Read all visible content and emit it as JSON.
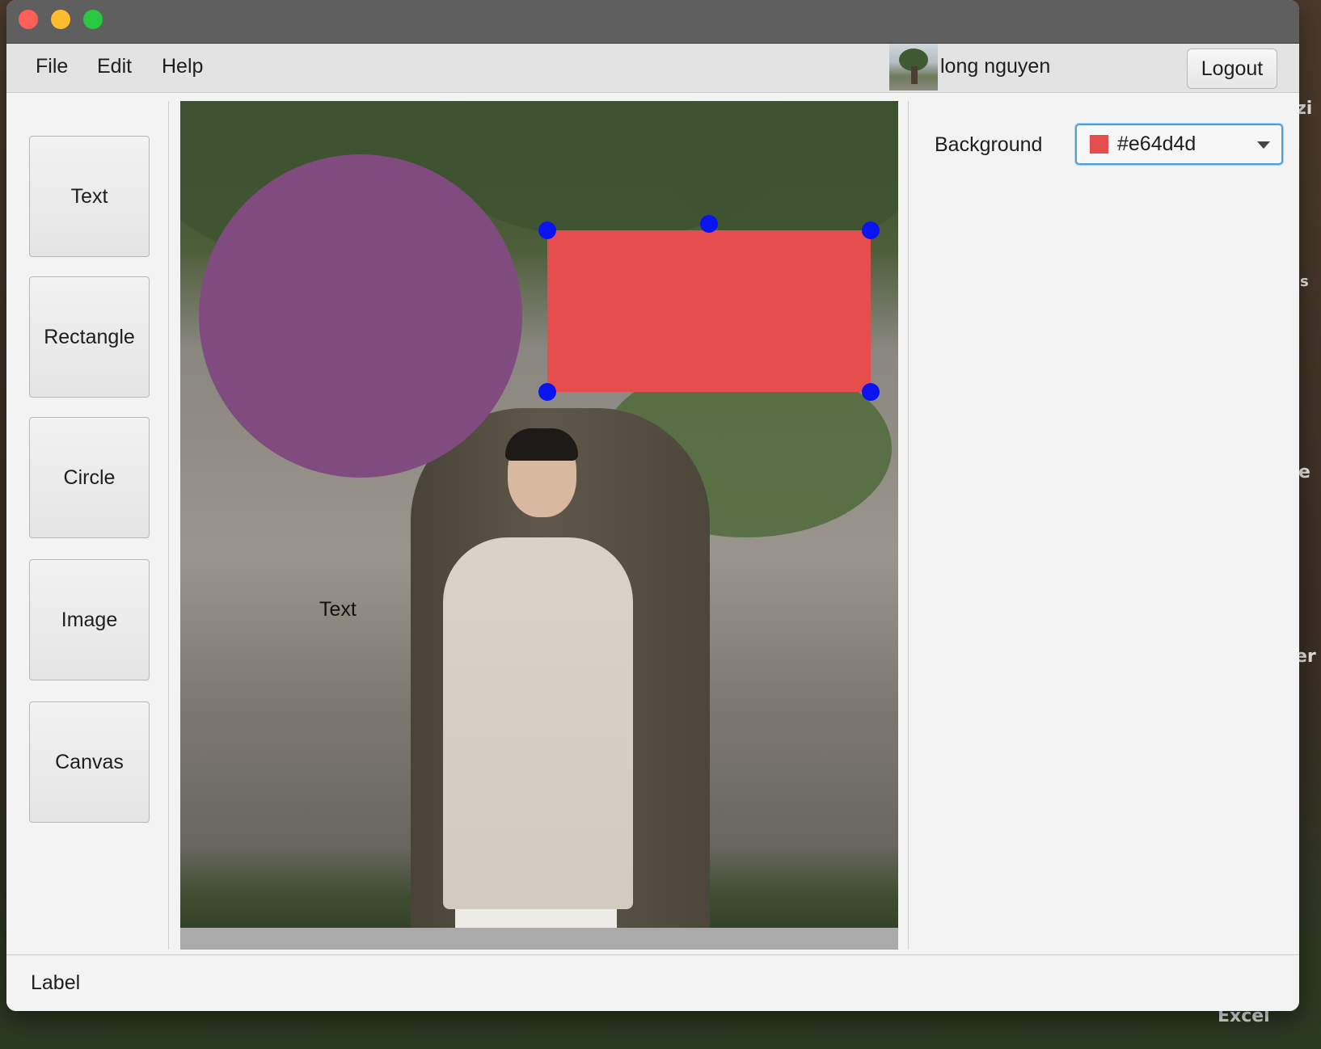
{
  "desktop": {
    "peek_labels": [
      "zi",
      "s",
      "e",
      "er",
      "Excel"
    ]
  },
  "menubar": {
    "items": [
      "File",
      "Edit",
      "Help"
    ],
    "username": "long nguyen",
    "logout_label": "Logout"
  },
  "toolbox": {
    "buttons": [
      "Text",
      "Rectangle",
      "Circle",
      "Image",
      "Canvas"
    ]
  },
  "canvas": {
    "text_label": "Text",
    "circle_color": "#804c80",
    "rect_color": "#e64d4d"
  },
  "properties": {
    "background_label": "Background",
    "background_value": "#e64d4d",
    "background_color": "#e64d4d"
  },
  "status": {
    "label": "Label"
  }
}
